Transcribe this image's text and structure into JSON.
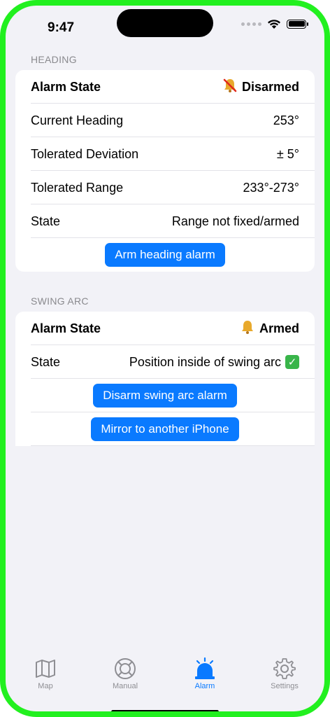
{
  "status": {
    "time": "9:47"
  },
  "heading": {
    "header": "HEADING",
    "alarm_state_label": "Alarm State",
    "alarm_state_value": "Disarmed",
    "current_heading_label": "Current Heading",
    "current_heading_value": "253°",
    "tolerated_deviation_label": "Tolerated Deviation",
    "tolerated_deviation_value": "± 5°",
    "tolerated_range_label": "Tolerated Range",
    "tolerated_range_value": "233°-273°",
    "state_label": "State",
    "state_value": "Range not fixed/armed",
    "arm_button": "Arm heading alarm"
  },
  "swing_arc": {
    "header": "SWING ARC",
    "alarm_state_label": "Alarm State",
    "alarm_state_value": "Armed",
    "state_label": "State",
    "state_value": "Position inside of swing arc",
    "disarm_button": "Disarm swing arc alarm",
    "mirror_button": "Mirror to another iPhone"
  },
  "tabs": [
    {
      "label": "Map",
      "icon": "map-icon"
    },
    {
      "label": "Manual",
      "icon": "lifebuoy-icon"
    },
    {
      "label": "Alarm",
      "icon": "alarm-siren-icon"
    },
    {
      "label": "Settings",
      "icon": "gear-icon"
    }
  ],
  "colors": {
    "accent": "#0a7aff",
    "frame": "#22f01f",
    "background": "#f2f2f7"
  }
}
